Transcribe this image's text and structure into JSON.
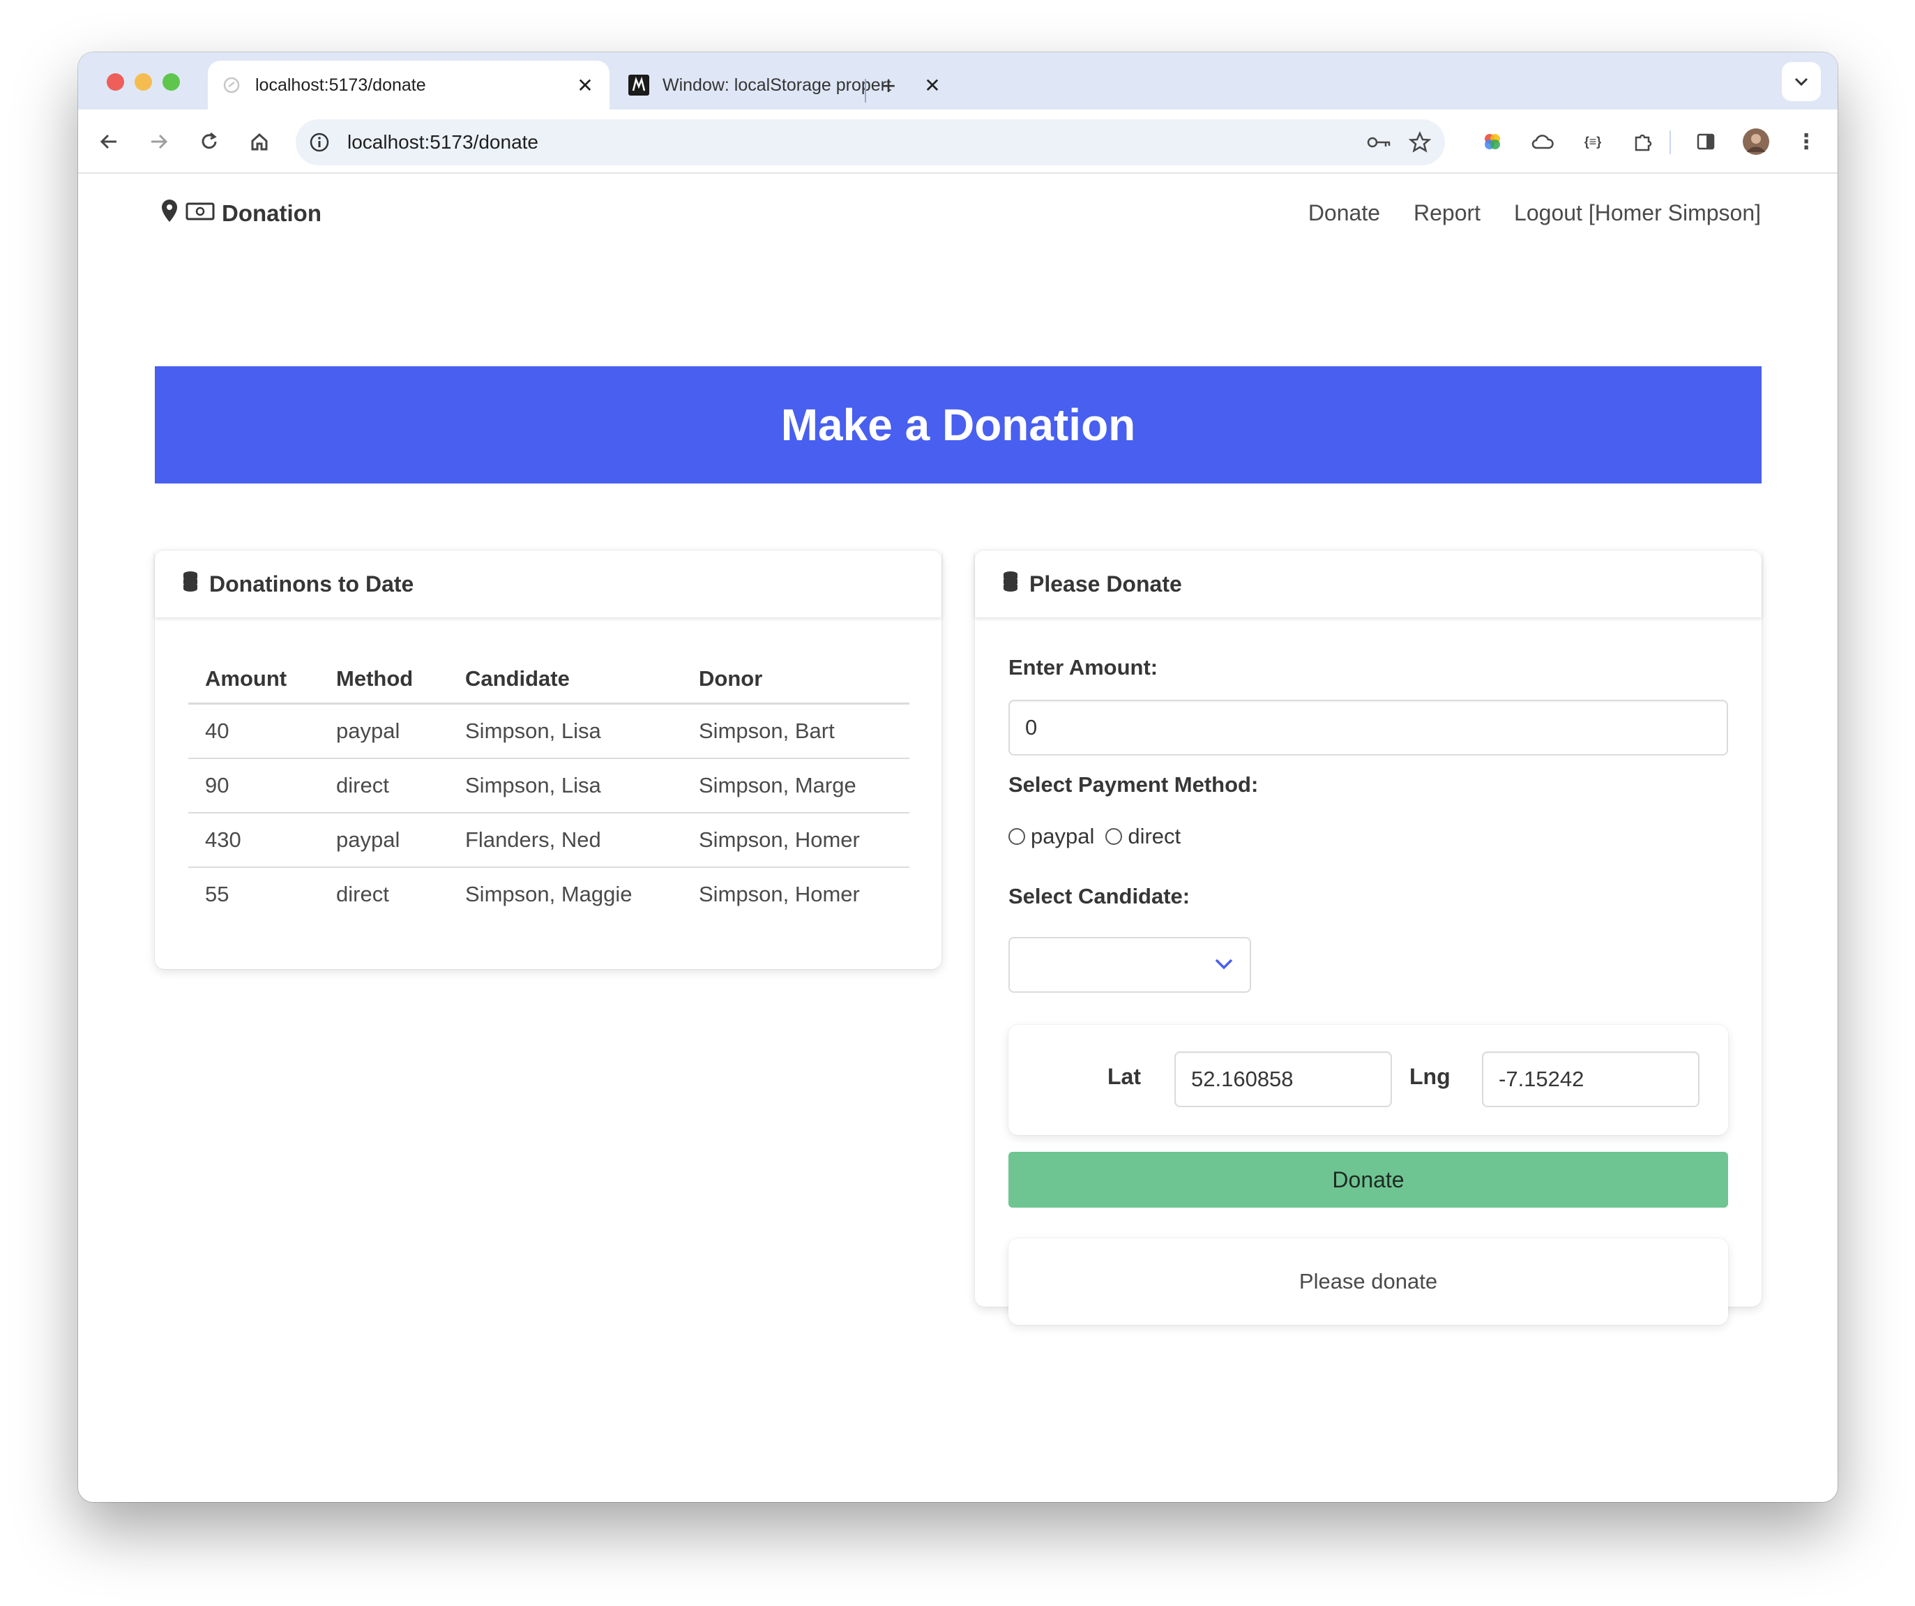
{
  "browser": {
    "tabs": [
      {
        "title": "localhost:5173/donate",
        "active": true
      },
      {
        "title": "Window: localStorage propert",
        "active": false
      }
    ],
    "url": "localhost:5173/donate"
  },
  "navbar": {
    "brand": "Donation",
    "links": [
      "Donate",
      "Report",
      "Logout [Homer Simpson]"
    ]
  },
  "hero": {
    "title": "Make a Donation"
  },
  "donations_card": {
    "title": "Donatinons to Date",
    "columns": [
      "Amount",
      "Method",
      "Candidate",
      "Donor"
    ],
    "rows": [
      [
        "40",
        "paypal",
        "Simpson, Lisa",
        "Simpson, Bart"
      ],
      [
        "90",
        "direct",
        "Simpson, Lisa",
        "Simpson, Marge"
      ],
      [
        "430",
        "paypal",
        "Flanders, Ned",
        "Simpson, Homer"
      ],
      [
        "55",
        "direct",
        "Simpson, Maggie",
        "Simpson, Homer"
      ]
    ]
  },
  "donate_form": {
    "title": "Please Donate",
    "amount_label": "Enter Amount:",
    "amount_value": "0",
    "method_label": "Select Payment Method:",
    "methods": [
      "paypal",
      "direct"
    ],
    "candidate_label": "Select Candidate:",
    "candidate_value": "",
    "lat_label": "Lat",
    "lat_value": "52.160858",
    "lng_label": "Lng",
    "lng_value": "-7.15242",
    "submit_label": "Donate",
    "message": "Please donate"
  },
  "colors": {
    "hero": "#485fef",
    "donate_button": "#6ec591",
    "tab_strip": "#dfe7f6"
  }
}
